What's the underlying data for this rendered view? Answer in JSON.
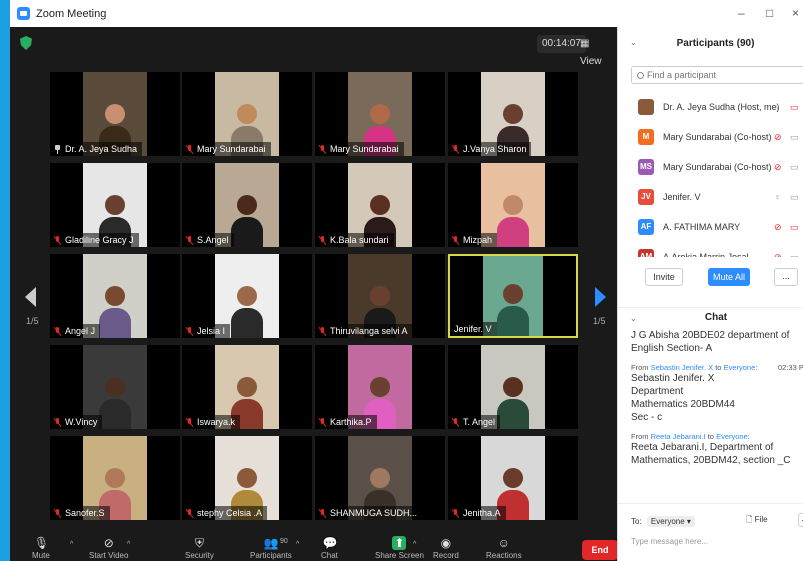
{
  "window": {
    "title": "Zoom Meeting",
    "minimize": "–",
    "maximize": "□",
    "close": "×"
  },
  "meeting": {
    "timer": "00:14:07",
    "view_label": "View",
    "page_left": "1/5",
    "page_right": "1/5",
    "security_color": "#27ae60",
    "active_speaker_border": "#d8d84a"
  },
  "tiles": [
    {
      "name": "Dr. A. Jeya Sudha",
      "muted": false,
      "pinned": true,
      "bg": "#5a4a3a",
      "skin": "#c89070",
      "cloth": "#3a2a1a"
    },
    {
      "name": "Mary Sundarabai",
      "muted": true,
      "bg": "#c8b9a2",
      "skin": "#c08a5a",
      "cloth": "#8a7a6a"
    },
    {
      "name": "Mary Sundarabai",
      "muted": true,
      "bg": "#7a6a5a",
      "skin": "#b06a4a",
      "cloth": "#d63384"
    },
    {
      "name": "J.Vanya Sharon",
      "muted": true,
      "bg": "#d8d0c4",
      "skin": "#6a4030",
      "cloth": "#3a2a2a"
    },
    {
      "name": "Gladiline Gracy J",
      "muted": true,
      "bg": "#e6e6e6",
      "skin": "#6a4030",
      "cloth": "#2a2a2a"
    },
    {
      "name": "S.Angel",
      "muted": true,
      "bg": "#b8a894",
      "skin": "#4a2a1a",
      "cloth": "#1a1a1a"
    },
    {
      "name": "K.Bala sundari",
      "muted": true,
      "bg": "#d4c8b8",
      "skin": "#5a3020",
      "cloth": "#2a1a1a"
    },
    {
      "name": "Mizpah",
      "muted": true,
      "bg": "#e8c0a0",
      "skin": "#c08a6a",
      "cloth": "#d04080"
    },
    {
      "name": "Angel J",
      "muted": true,
      "bg": "#d0d0c8",
      "skin": "#7a4a30",
      "cloth": "#6a5a8a"
    },
    {
      "name": "Jelsia I",
      "muted": true,
      "bg": "#eeeeee",
      "skin": "#9a6a4a",
      "cloth": "#2a2a2a"
    },
    {
      "name": "Thiruvilanga selvi A",
      "muted": true,
      "bg": "#4a3a2a",
      "skin": "#6a4030",
      "cloth": "#1a1a1a"
    },
    {
      "name": "Jenifer. V",
      "muted": false,
      "active": true,
      "bg": "#6aa890",
      "skin": "#6a4030",
      "cloth": "#2a5a4a"
    },
    {
      "name": "W.Vincy",
      "muted": true,
      "bg": "#3a3a3a",
      "skin": "#4a3020",
      "cloth": "#2a2a2a"
    },
    {
      "name": "Iswarya.k",
      "muted": true,
      "bg": "#d8c8b0",
      "skin": "#8a5a3a",
      "cloth": "#8a3a2a"
    },
    {
      "name": "Karthika.P",
      "muted": true,
      "bg": "#c06aa0",
      "skin": "#6a4030",
      "cloth": "#e060c0"
    },
    {
      "name": "T. Angel",
      "muted": true,
      "bg": "#c8c8c0",
      "skin": "#5a3020",
      "cloth": "#2a4a3a"
    },
    {
      "name": "Sanofer.S",
      "muted": true,
      "bg": "#c8b080",
      "skin": "#b07a5a",
      "cloth": "#c06a6a"
    },
    {
      "name": "stephy Celsia .A",
      "muted": true,
      "bg": "#e6e0d8",
      "skin": "#8a5a3a",
      "cloth": "#b08a3a"
    },
    {
      "name": "SHANMUGA SUDH...",
      "muted": true,
      "bg": "#5a5048",
      "skin": "#a07a60",
      "cloth": "#3a3028"
    },
    {
      "name": "Jenitha.A",
      "muted": true,
      "bg": "#d8d8d8",
      "skin": "#6a3a2a",
      "cloth": "#c03030"
    }
  ],
  "toolbar": {
    "items": [
      {
        "label": "Mute",
        "icon": "microphone-icon",
        "caret": true
      },
      {
        "label": "Start Video",
        "icon": "video-off-icon",
        "caret": true
      },
      {
        "label": "Security",
        "icon": "shield-icon",
        "caret": false
      },
      {
        "label": "Participants",
        "icon": "participants-icon",
        "caret": true,
        "count": "90"
      },
      {
        "label": "Chat",
        "icon": "chat-icon",
        "caret": false
      },
      {
        "label": "Share Screen",
        "icon": "share-screen-icon",
        "caret": true
      },
      {
        "label": "Record",
        "icon": "record-icon",
        "caret": false
      },
      {
        "label": "Reactions",
        "icon": "reactions-icon",
        "caret": false
      }
    ],
    "end_label": "End"
  },
  "participants": {
    "title": "Participants (90)",
    "search_placeholder": "Find a participant",
    "list": [
      {
        "name": "Dr. A. Jeya Sudha (Host, me)",
        "avatar": "",
        "color": "#8a5a3a",
        "mic": "on",
        "video": "off"
      },
      {
        "name": "Mary Sundarabai (Co-host)",
        "avatar": "M",
        "color": "#f26d21",
        "mic": "off",
        "video": "on"
      },
      {
        "name": "Mary Sundarabai (Co-host)",
        "avatar": "MS",
        "color": "#9b59b6",
        "mic": "off",
        "video": "on"
      },
      {
        "name": "Jenifer. V",
        "avatar": "JV",
        "color": "#e74c3c",
        "mic": "on",
        "video": "on"
      },
      {
        "name": "A. FATHIMA MARY",
        "avatar": "AF",
        "color": "#2d8cff",
        "mic": "off",
        "video": "off"
      },
      {
        "name": "A.Arokia Marrin Jesal",
        "avatar": "AM",
        "color": "#c0392b",
        "mic": "off",
        "video": "on"
      }
    ],
    "invite_label": "Invite",
    "mute_all_label": "Mute All",
    "more_label": "..."
  },
  "chat": {
    "title": "Chat",
    "messages": [
      {
        "from": "",
        "to": "",
        "time": "",
        "text": "J G Abisha 20BDE02 department of English Section- A"
      },
      {
        "from": "Sebastin Jenifer. X",
        "to": "Everyone",
        "time": "02:33 PM",
        "text": "Sebastin Jenifer. X Department Mathematics 20BDM44 Sec - c"
      },
      {
        "from": "Reeta Jebarani.I",
        "to": "Everyone",
        "time": "",
        "text": "Reeta Jebarani.I, Department of Mathematics, 20BDM42, section _C"
      }
    ],
    "from_word": "From",
    "to_word": "to",
    "to_label": "To:",
    "to_value": "Everyone",
    "file_label": "File",
    "more_label": "...",
    "input_placeholder": "Type message here..."
  }
}
